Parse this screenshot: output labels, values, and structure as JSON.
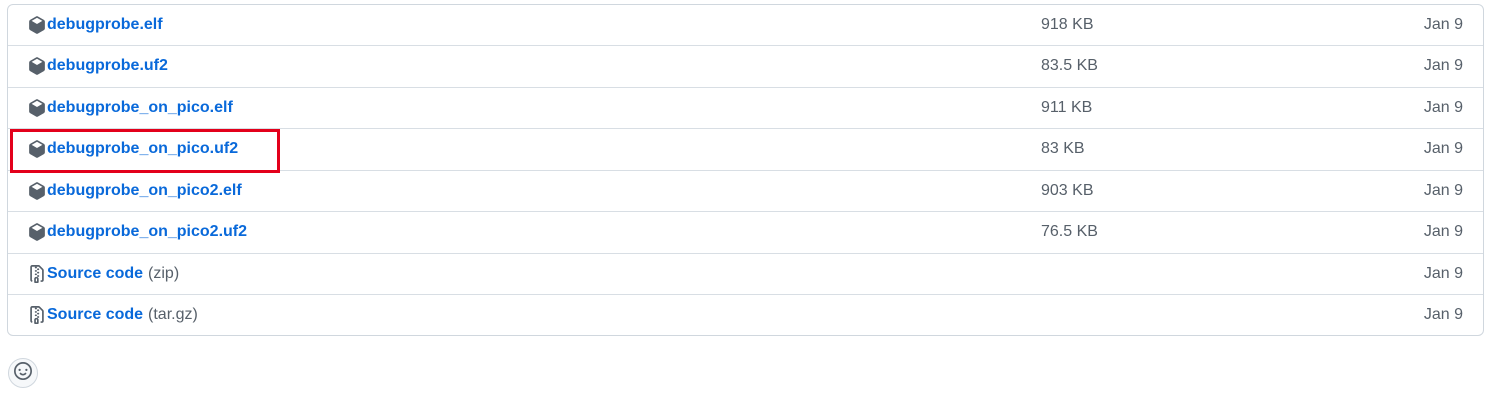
{
  "assets": [
    {
      "name": "debugprobe.elf",
      "suffix": "",
      "size": "918 KB",
      "date": "Jan 9",
      "icon": "package-icon"
    },
    {
      "name": "debugprobe.uf2",
      "suffix": "",
      "size": "83.5 KB",
      "date": "Jan 9",
      "icon": "package-icon"
    },
    {
      "name": "debugprobe_on_pico.elf",
      "suffix": "",
      "size": "911 KB",
      "date": "Jan 9",
      "icon": "package-icon"
    },
    {
      "name": "debugprobe_on_pico.uf2",
      "suffix": "",
      "size": "83 KB",
      "date": "Jan 9",
      "icon": "package-icon"
    },
    {
      "name": "debugprobe_on_pico2.elf",
      "suffix": "",
      "size": "903 KB",
      "date": "Jan 9",
      "icon": "package-icon"
    },
    {
      "name": "debugprobe_on_pico2.uf2",
      "suffix": "",
      "size": "76.5 KB",
      "date": "Jan 9",
      "icon": "package-icon"
    },
    {
      "name": "Source code",
      "suffix": "(zip)",
      "size": "",
      "date": "Jan 9",
      "icon": "file-zip-icon"
    },
    {
      "name": "Source code",
      "suffix": "(tar.gz)",
      "size": "",
      "date": "Jan 9",
      "icon": "file-zip-icon"
    }
  ],
  "colors": {
    "link": "#0969da",
    "muted": "#57606a",
    "highlight": "#e3001b"
  },
  "reaction_icon": "smiley-icon"
}
